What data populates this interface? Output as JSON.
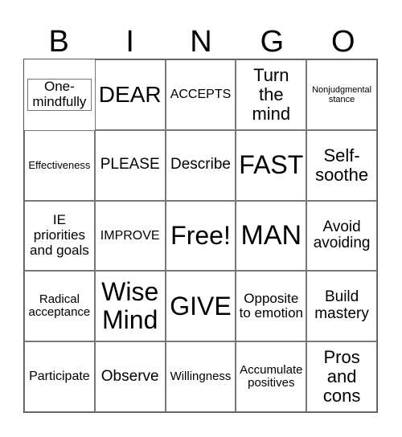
{
  "header": {
    "letters": [
      "B",
      "I",
      "N",
      "G",
      "O"
    ]
  },
  "cells": [
    "One-mindfully",
    "DEAR",
    "ACCEPTS",
    "Turn the mind",
    "Nonjudgmental stance",
    "Effectiveness",
    "PLEASE",
    "Describe",
    "FAST",
    "Self-soothe",
    "IE priorities and goals",
    "IMPROVE",
    "Free!",
    "MAN",
    "Avoid avoiding",
    "Radical acceptance",
    "Wise Mind",
    "GIVE",
    "Opposite to emotion",
    "Build mastery",
    "Participate",
    "Observe",
    "Willingness",
    "Accumulate positives",
    "Pros and cons"
  ]
}
